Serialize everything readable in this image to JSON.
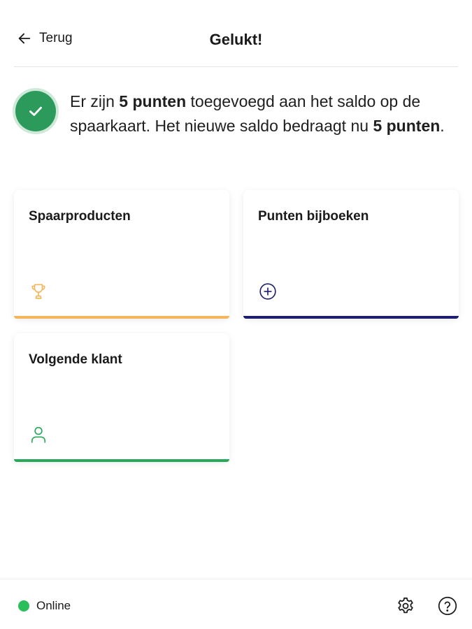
{
  "header": {
    "back_label": "Terug",
    "title": "Gelukt!"
  },
  "success": {
    "icon": "check-circle-icon",
    "text_1": "Er zijn ",
    "points_added": "5 punten",
    "text_2": " toegevoegd aan het saldo op de spaarkaart. Het nieuwe saldo bedraagt nu ",
    "new_balance": "5 punten",
    "text_3": "."
  },
  "tiles": [
    {
      "label": "Spaarproducten",
      "icon": "trophy-icon",
      "color": "#f5b55a"
    },
    {
      "label": "Punten bijboeken",
      "icon": "plus-circle-icon",
      "color": "#1e1e6e"
    },
    {
      "label": "Volgende klant",
      "icon": "user-icon",
      "color": "#27a85a"
    }
  ],
  "footer": {
    "status_label": "Online",
    "status_color": "#2bbf5c",
    "settings_icon": "gear-icon",
    "help_icon": "question-circle-icon"
  }
}
